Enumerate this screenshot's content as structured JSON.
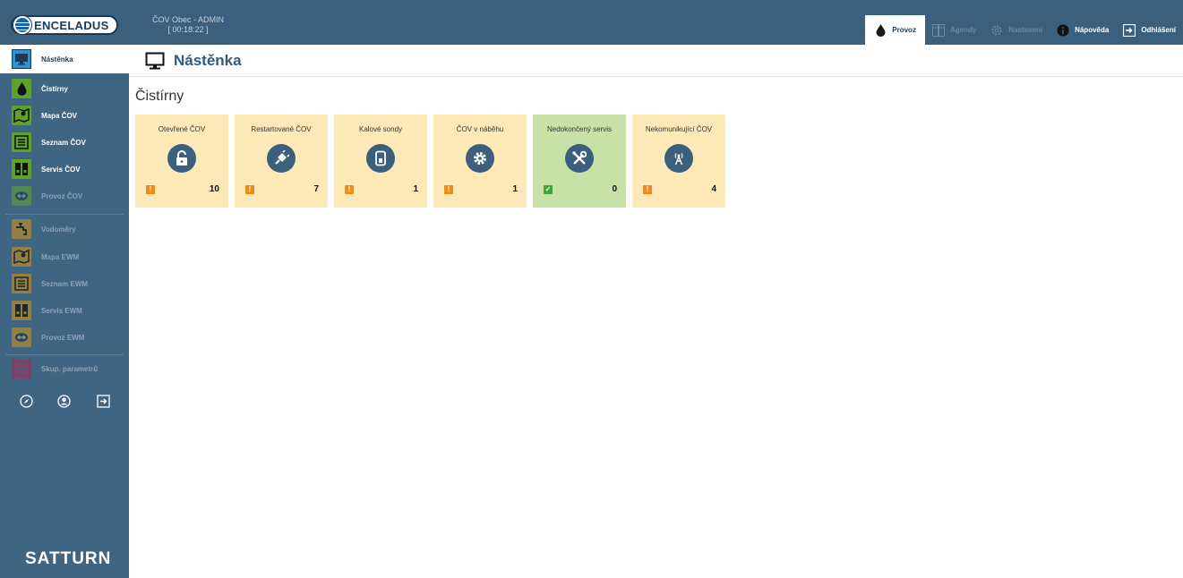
{
  "header": {
    "logo_text": "ENCELADUS",
    "session_title": "ČOV Obec - ADMIN",
    "session_timer": "[ 00:18:22 ]",
    "nav": [
      {
        "label": "Provoz",
        "icon": "drop-icon",
        "state": "active"
      },
      {
        "label": "Agendy",
        "icon": "binders-icon",
        "state": "disabled"
      },
      {
        "label": "Nastavení",
        "icon": "gear-icon",
        "state": "disabled"
      },
      {
        "label": "Nápověda",
        "icon": "info-icon",
        "state": "normal"
      },
      {
        "label": "Odhlášení",
        "icon": "logout-icon",
        "state": "normal"
      }
    ]
  },
  "sidebar": {
    "active": {
      "label": "Nástěnka",
      "icon": "monitor-icon"
    },
    "items": [
      {
        "label": "Čistírny",
        "icon": "drop-icon",
        "color": "#5da32a",
        "state": "normal"
      },
      {
        "label": "Mapa ČOV",
        "icon": "map-pin-icon",
        "color": "#5da32a",
        "state": "normal"
      },
      {
        "label": "Seznam ČOV",
        "icon": "list-icon",
        "color": "#5da32a",
        "state": "normal"
      },
      {
        "label": "Servis ČOV",
        "icon": "binders-icon",
        "color": "#5da32a",
        "state": "normal"
      },
      {
        "label": "Provoz ČOV",
        "icon": "swap-icon",
        "color": "#5da32a",
        "state": "disabled"
      },
      {
        "label": "Vodoměry",
        "icon": "faucet-icon",
        "color": "#b08a2e",
        "state": "disabled"
      },
      {
        "label": "Mapa EWM",
        "icon": "map-pin-icon",
        "color": "#b08a2e",
        "state": "disabled"
      },
      {
        "label": "Seznam EWM",
        "icon": "list-icon",
        "color": "#b08a2e",
        "state": "disabled"
      },
      {
        "label": "Servis EWM",
        "icon": "binders-icon",
        "color": "#b08a2e",
        "state": "disabled"
      },
      {
        "label": "Provoz EWM",
        "icon": "swap-icon",
        "color": "#b08a2e",
        "state": "disabled"
      },
      {
        "label": "Skup. parametrů",
        "icon": "group-icon",
        "color": "#8a3a64",
        "state": "disabled"
      }
    ],
    "bottom_icons": [
      "compass-icon",
      "user-icon",
      "logout-icon"
    ],
    "brand": "SATTURN"
  },
  "page": {
    "title": "Nástěnka",
    "section_title": "Čistírny",
    "tiles": [
      {
        "label": "Otevřené ČOV",
        "icon": "unlock-icon",
        "count": "10",
        "status": "warning"
      },
      {
        "label": "Restartované ČOV",
        "icon": "plug-icon",
        "count": "7",
        "status": "warning"
      },
      {
        "label": "Kalové sondy",
        "icon": "probe-icon",
        "count": "1",
        "status": "warning"
      },
      {
        "label": "ČOV v náběhu",
        "icon": "gear-icon",
        "count": "1",
        "status": "warning"
      },
      {
        "label": "Nedokončený servis",
        "icon": "tools-icon",
        "count": "0",
        "status": "ok"
      },
      {
        "label": "Nekomunikující ČOV",
        "icon": "antenna-icon",
        "count": "4",
        "status": "warning"
      }
    ]
  },
  "colors": {
    "topbar": "#3a607d",
    "sidebar": "#3e6582",
    "tile_warning": "#fde9b7",
    "tile_ok": "#c6e2a6",
    "accent_title": "#30597a"
  }
}
